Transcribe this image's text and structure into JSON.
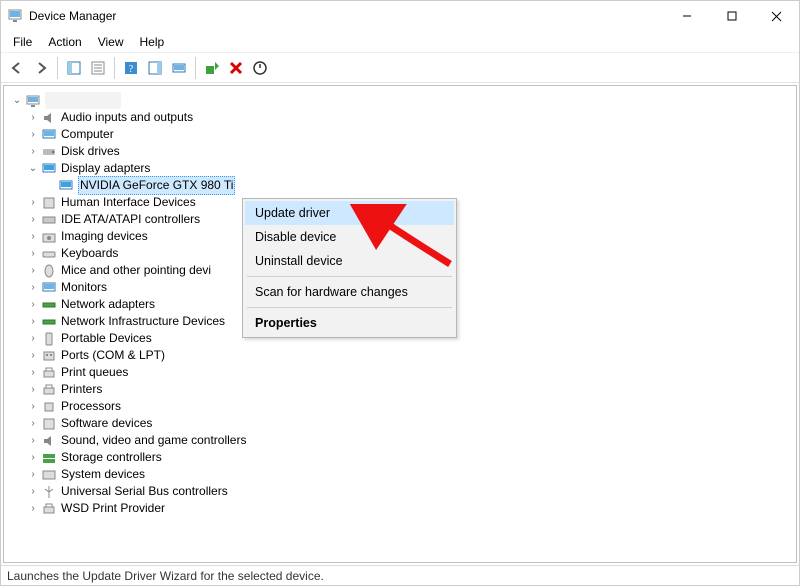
{
  "window": {
    "title": "Device Manager"
  },
  "menu": {
    "file": "File",
    "action": "Action",
    "view": "View",
    "help": "Help"
  },
  "root_name": "",
  "tree": {
    "audio": "Audio inputs and outputs",
    "computer": "Computer",
    "disks": "Disk drives",
    "display": "Display adapters",
    "display_child": "NVIDIA GeForce GTX 980 Ti",
    "hid": "Human Interface Devices",
    "ide": "IDE ATA/ATAPI controllers",
    "imaging": "Imaging devices",
    "keyboards": "Keyboards",
    "mice": "Mice and other pointing devi",
    "monitors": "Monitors",
    "network": "Network adapters",
    "netinfra": "Network Infrastructure Devices",
    "portable": "Portable Devices",
    "ports": "Ports (COM & LPT)",
    "printqueues": "Print queues",
    "printers": "Printers",
    "processors": "Processors",
    "softwaredev": "Software devices",
    "sound": "Sound, video and game controllers",
    "storage": "Storage controllers",
    "system": "System devices",
    "usb": "Universal Serial Bus controllers",
    "wsd": "WSD Print Provider"
  },
  "context_menu": {
    "update": "Update driver",
    "disable": "Disable device",
    "uninstall": "Uninstall device",
    "scan": "Scan for hardware changes",
    "properties": "Properties"
  },
  "status": "Launches the Update Driver Wizard for the selected device."
}
